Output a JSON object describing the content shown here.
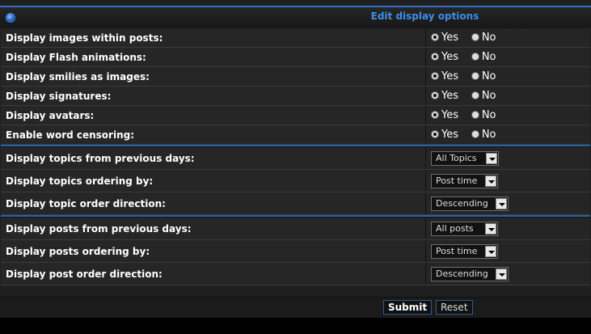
{
  "header": {
    "title": "Edit display options"
  },
  "radio_rows": [
    {
      "label": "Display images within posts:",
      "yes": "Yes",
      "no": "No",
      "selected": "yes"
    },
    {
      "label": "Display Flash animations:",
      "yes": "Yes",
      "no": "No",
      "selected": "yes"
    },
    {
      "label": "Display smilies as images:",
      "yes": "Yes",
      "no": "No",
      "selected": "yes"
    },
    {
      "label": "Display signatures:",
      "yes": "Yes",
      "no": "No",
      "selected": "yes"
    },
    {
      "label": "Display avatars:",
      "yes": "Yes",
      "no": "No",
      "selected": "yes"
    },
    {
      "label": "Enable word censoring:",
      "yes": "Yes",
      "no": "No",
      "selected": "yes"
    }
  ],
  "topic_rows": [
    {
      "label": "Display topics from previous days:",
      "value": "All Topics"
    },
    {
      "label": "Display topics ordering by:",
      "value": "Post time"
    },
    {
      "label": "Display topic order direction:",
      "value": "Descending"
    }
  ],
  "post_rows": [
    {
      "label": "Display posts from previous days:",
      "value": "All posts"
    },
    {
      "label": "Display posts ordering by:",
      "value": "Post time"
    },
    {
      "label": "Display post order direction:",
      "value": "Descending"
    }
  ],
  "buttons": {
    "submit": "Submit",
    "reset": "Reset"
  }
}
